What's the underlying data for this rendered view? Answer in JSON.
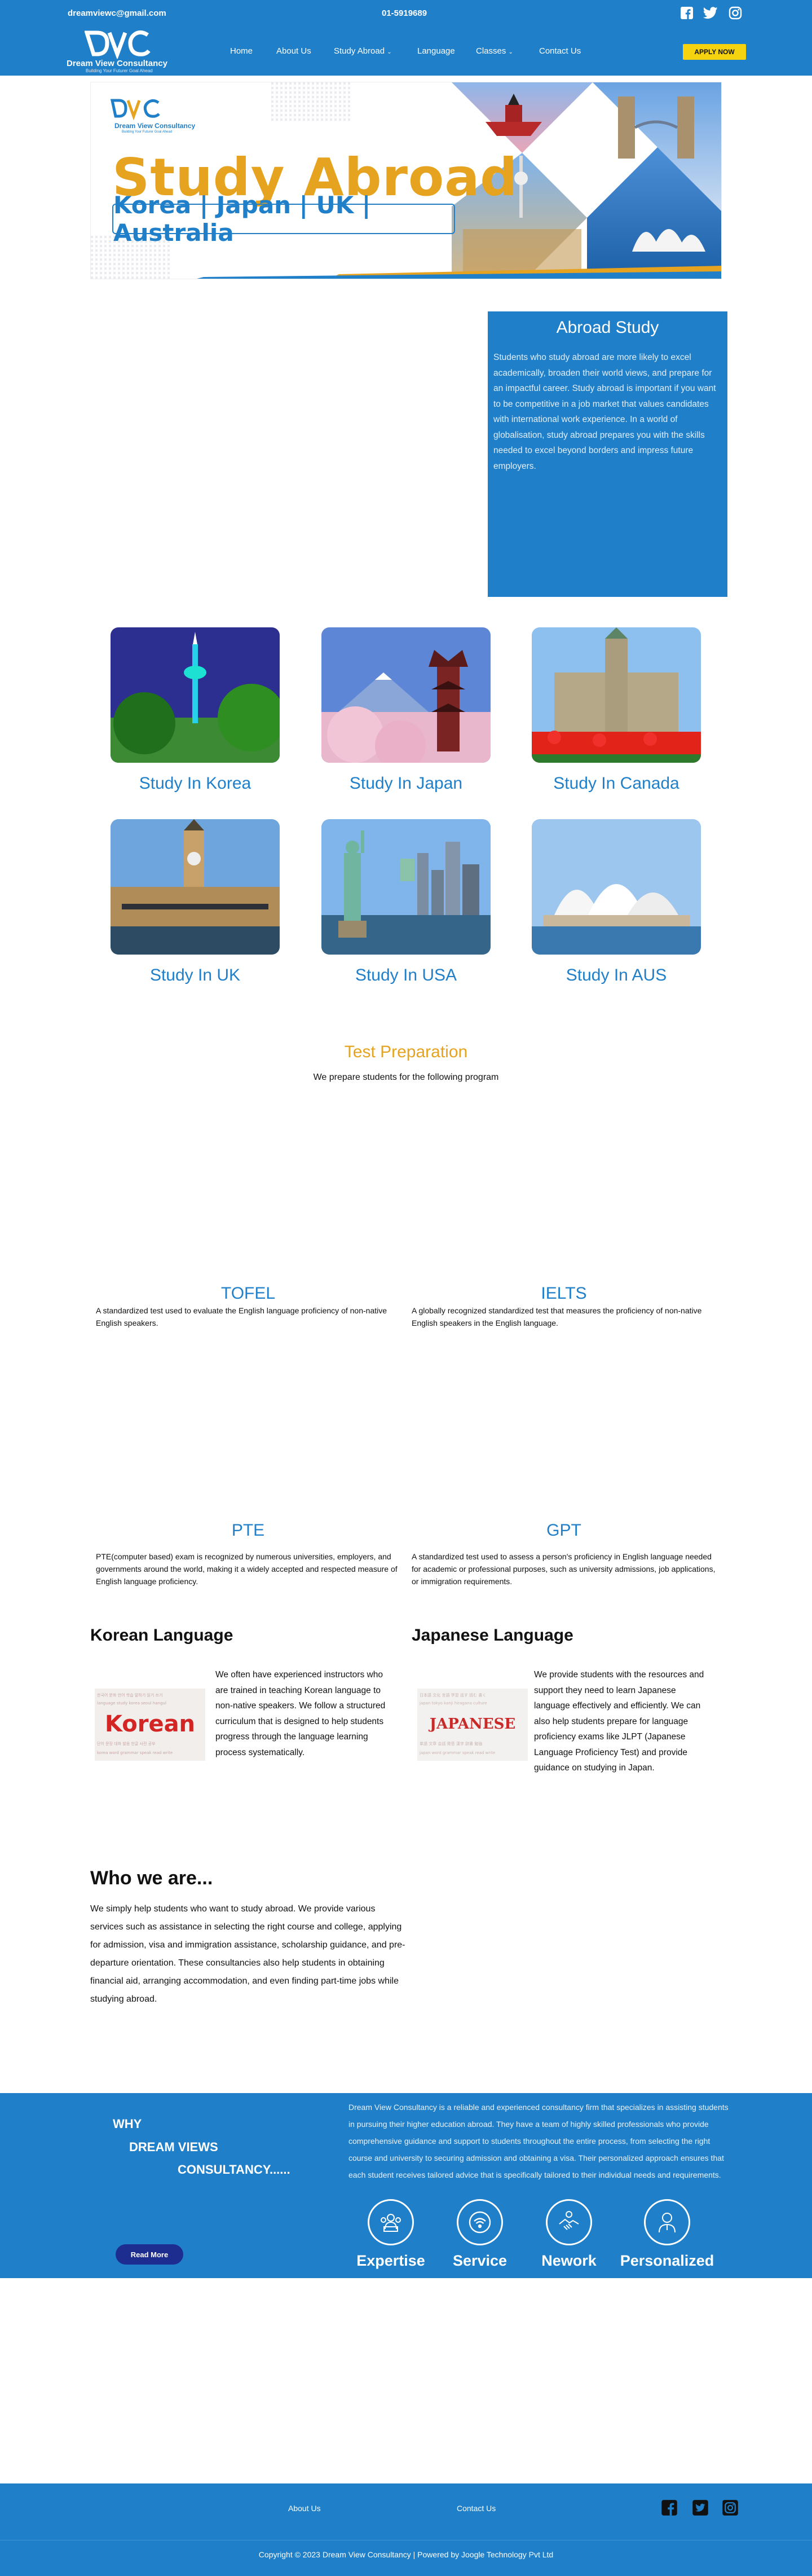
{
  "topbar": {
    "email": "dreamviewc@gmail.com",
    "phone": "01-5919689",
    "social": [
      "facebook-icon",
      "twitter-icon",
      "instagram-icon"
    ]
  },
  "nav": {
    "logo_name": "Dream View Consultancy",
    "logo_tagline": "Building Your Futurer Goal Ahead",
    "items": [
      "Home",
      "About Us",
      "Study Abroad",
      "Language",
      "Classes",
      "Contact Us"
    ],
    "apply": "APPLY NOW"
  },
  "banner": {
    "logo_name": "Dream View Consultancy",
    "logo_tagline": "Building Your Futurer Goal Ahead",
    "title": "Study Abroad",
    "countries": "Korea | Japan | UK | Australia"
  },
  "abroad": {
    "title": "Abroad Study",
    "text": "Students who study abroad are more likely to excel academically, broaden their world views, and prepare for an impactful career. Study abroad is important if you want to be competitive in a job market that values candidates with international work experience. In a world of globalisation, study abroad prepares you with the skills needed to excel beyond borders and impress future employers."
  },
  "destinations": [
    {
      "title": "Study In Korea"
    },
    {
      "title": "Study In Japan"
    },
    {
      "title": "Study In Canada"
    },
    {
      "title": "Study In UK"
    },
    {
      "title": "Study In USA"
    },
    {
      "title": "Study In AUS"
    }
  ],
  "tests": {
    "title": "Test Preparation",
    "subtitle": "We prepare students for the following program",
    "items": [
      {
        "name": "TOFEL",
        "desc": "A standardized test used to evaluate the English language proficiency of non-native English speakers."
      },
      {
        "name": "IELTS",
        "desc": "A globally recognized standardized test that measures the proficiency of non-native English speakers in the English language."
      },
      {
        "name": "PTE",
        "desc": "PTE(computer based) exam is recognized by numerous universities, employers, and governments around the world, making it a widely accepted and respected measure of English language proficiency."
      },
      {
        "name": "GPT",
        "desc": "A standardized test used to assess a person's proficiency in English language needed for academic or professional purposes, such as university admissions, job applications, or immigration requirements."
      }
    ]
  },
  "languages": {
    "korean": {
      "title": "Korean Language",
      "image_word": "Korean",
      "text": "We often have experienced instructors who are trained in teaching Korean language to non-native speakers. We follow a structured curriculum that is designed to help students progress through the language learning process systematically."
    },
    "japanese": {
      "title": "Japanese Language",
      "image_word": "JAPANESE",
      "text": "We provide students with the resources and support they need to learn Japanese language effectively and efficiently. We can also help students prepare for language proficiency exams like JLPT (Japanese Language Proficiency Test) and provide guidance on studying in Japan."
    }
  },
  "who": {
    "title": "Who we are...",
    "text": "We simply  help students who want to study abroad. We provide various services such as assistance in selecting the right course and college, applying for admission, visa and immigration assistance, scholarship guidance, and pre-departure orientation. These consultancies also help students in obtaining financial aid, arranging accommodation, and even finding part-time jobs while studying abroad."
  },
  "why": {
    "line1": "WHY",
    "line2": "DREAM VIEWS",
    "line3": "CONSULTANCY......",
    "text": "Dream View Consultancy is a reliable and experienced consultancy firm that specializes in assisting students in pursuing their higher education abroad. They have a team of highly skilled professionals who provide comprehensive guidance and support to students throughout the entire process, from selecting the right course and university to securing admission and obtaining a visa. Their personalized approach ensures that each student receives tailored advice that is specifically tailored to their individual needs and requirements.",
    "read_more": "Read More",
    "features": [
      {
        "label": "Expertise",
        "icon": "team-icon"
      },
      {
        "label": "Service",
        "icon": "wifi-icon"
      },
      {
        "label": "Nework",
        "icon": "handshake-icon"
      },
      {
        "label": "Personalized",
        "icon": "person-icon"
      }
    ]
  },
  "footer": {
    "links": [
      "About Us",
      "Contact Us"
    ],
    "copyright": "Copyright © 2023 Dream View Consultancy | Powered by Joogle Technology Pvt Ltd"
  },
  "colors": {
    "primary": "#1f7fc9",
    "accent": "#e5a320",
    "button": "#f5d40f",
    "dark": "#1d2c8f"
  }
}
